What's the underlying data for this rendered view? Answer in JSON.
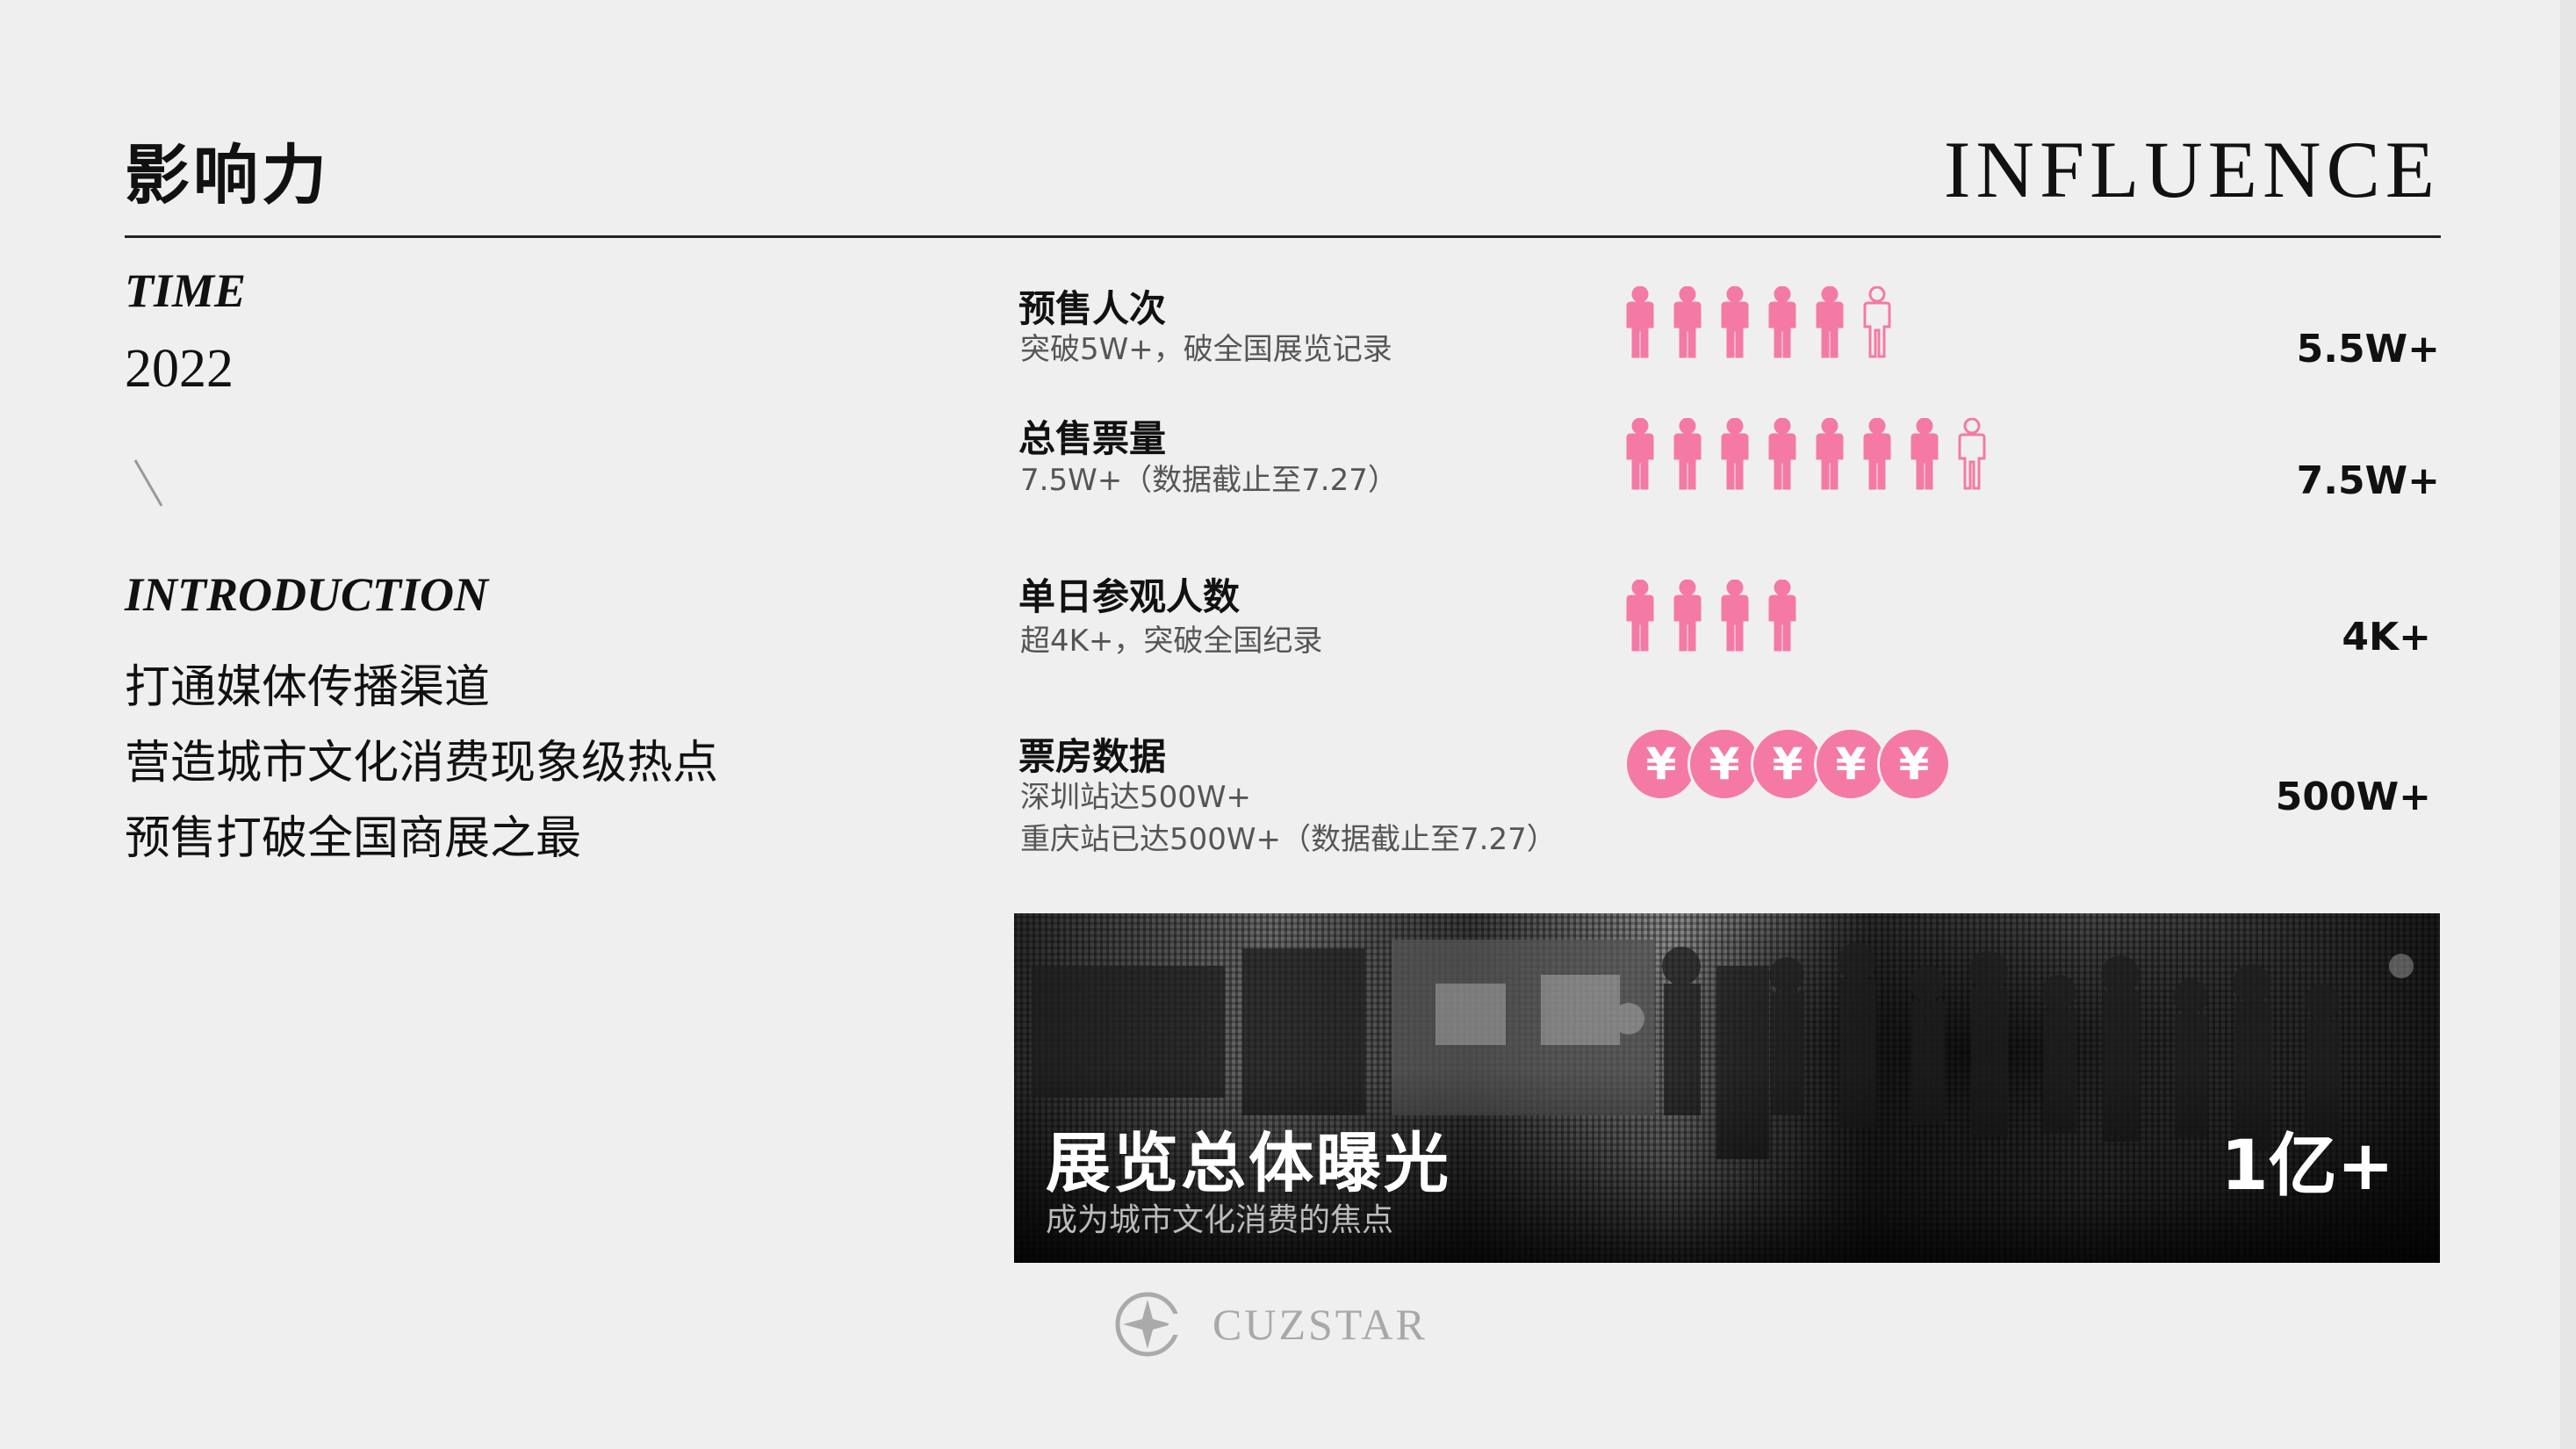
{
  "header": {
    "title_cn": "影响力",
    "title_en": "INFLUENCE"
  },
  "time": {
    "label": "TIME",
    "value": "2022"
  },
  "introduction": {
    "label": "INTRODUCTION",
    "lines": [
      "打通媒体传播渠道",
      "营造城市文化消费现象级热点",
      "预售打破全国商展之最"
    ]
  },
  "stats": [
    {
      "title": "预售人次",
      "desc": [
        "突破5W+，破全国展览记录"
      ],
      "icon": "person-icon",
      "filled": 5,
      "total": 6,
      "value": "5.5W+"
    },
    {
      "title": "总售票量",
      "desc": [
        "7.5W+（数据截止至7.27）"
      ],
      "icon": "person-icon",
      "filled": 7,
      "total": 8,
      "value": "7.5W+"
    },
    {
      "title": "单日参观人数",
      "desc": [
        "超4K+，突破全国纪录"
      ],
      "icon": "person-icon",
      "filled": 4,
      "total": 4,
      "value": "4K+"
    },
    {
      "title": "票房数据",
      "desc": [
        "深圳站达500W+",
        "重庆站已达500W+（数据截止至7.27）"
      ],
      "icon": "yuan-coin-icon",
      "coin_symbol": "¥",
      "filled": 5,
      "total": 5,
      "value": "500W+"
    }
  ],
  "banner": {
    "title": "展览总体曝光",
    "subtitle": "成为城市文化消费的焦点",
    "value": "1亿+"
  },
  "logo": {
    "text": "CUZSTAR",
    "icon": "star-compass-icon"
  },
  "colors": {
    "accent_pink": "#f47aa5",
    "background": "#efefef",
    "text": "#111111"
  }
}
